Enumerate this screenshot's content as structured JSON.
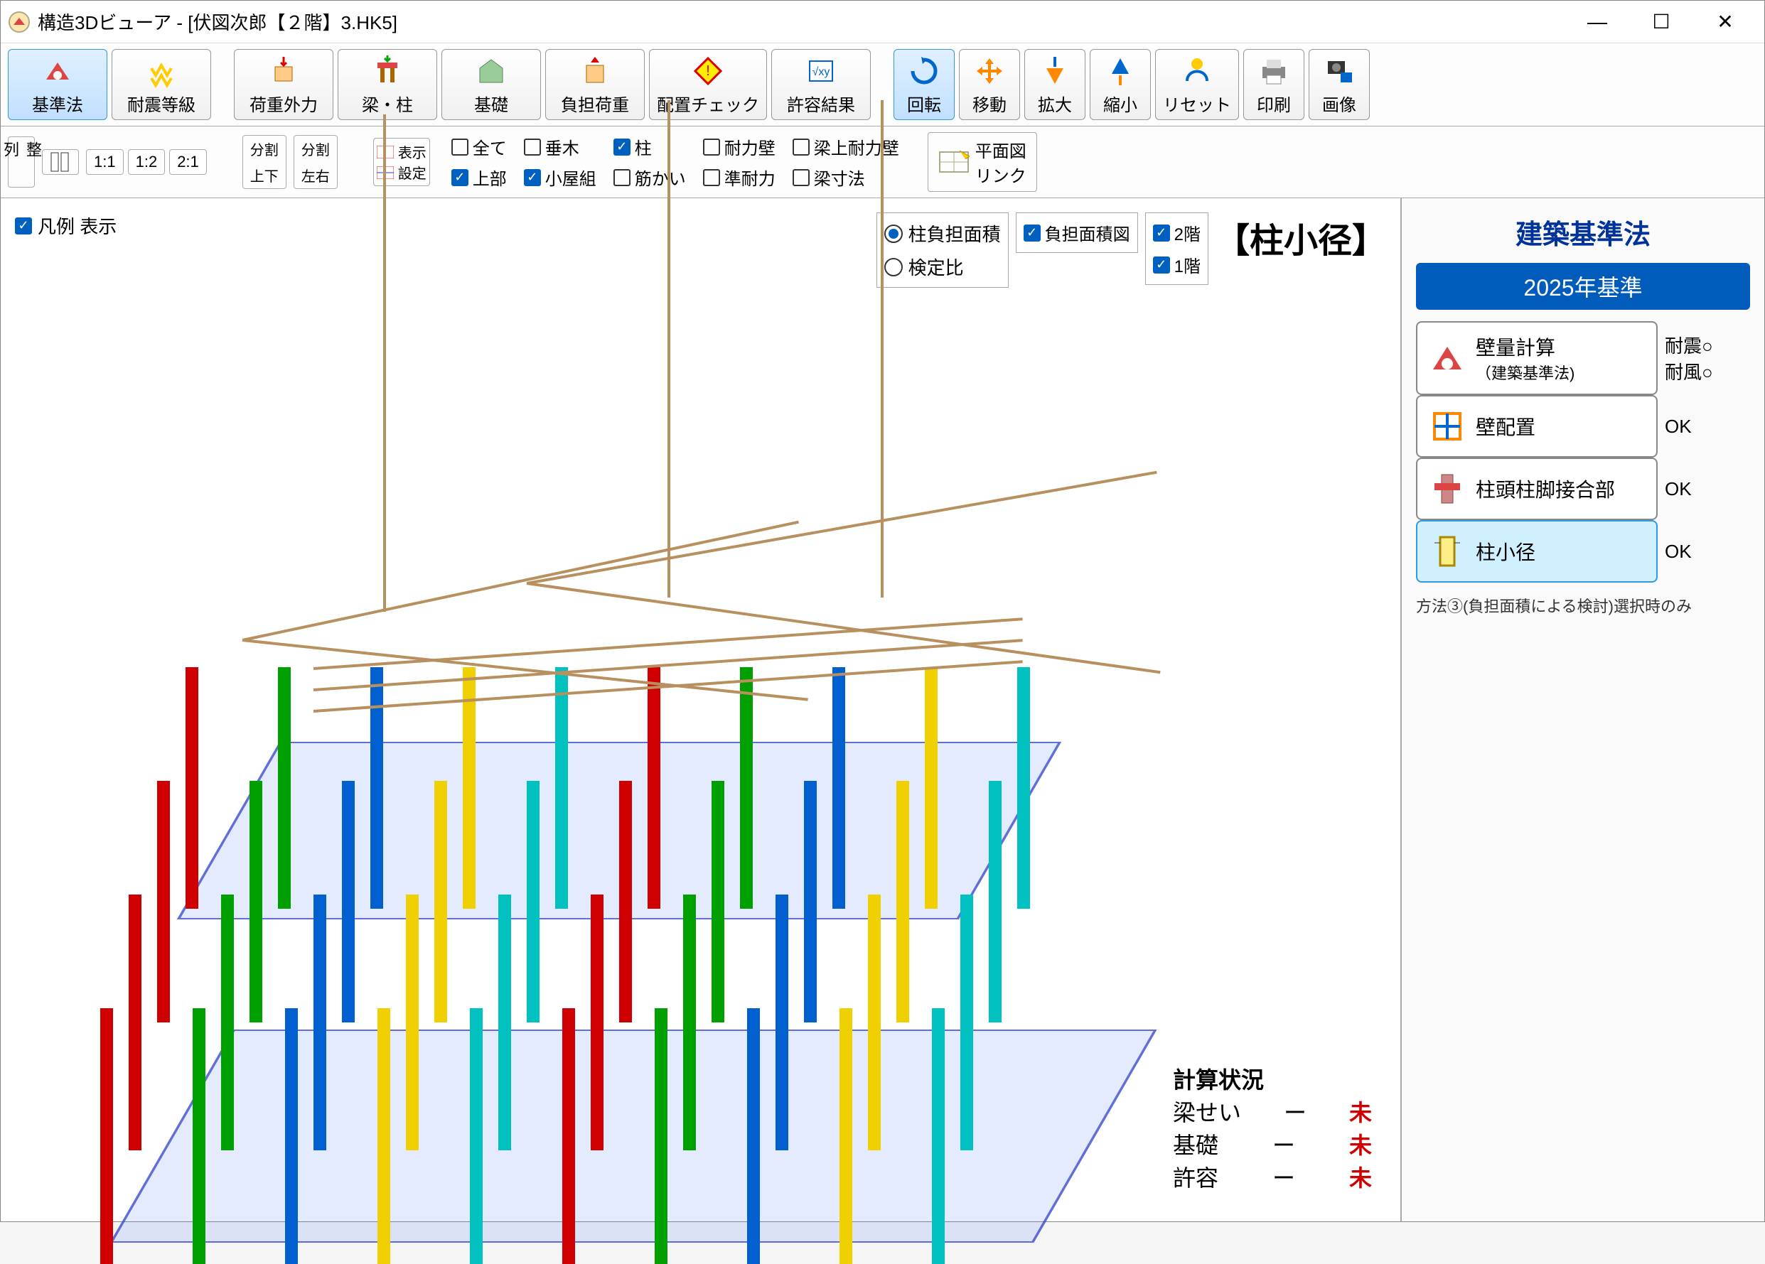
{
  "window": {
    "title": "構造3Dビューア - [伏図次郎【２階】3.HK5]"
  },
  "toolbar": [
    {
      "id": "kijun",
      "label": "基準法",
      "active": true
    },
    {
      "id": "taisin",
      "label": "耐震等級"
    },
    {
      "id": "kaju",
      "label": "荷重外力"
    },
    {
      "id": "hari",
      "label": "梁・柱"
    },
    {
      "id": "kiso",
      "label": "基礎"
    },
    {
      "id": "futan",
      "label": "負担荷重"
    },
    {
      "id": "haichi",
      "label": "配置チェック"
    },
    {
      "id": "kyoyo",
      "label": "許容結果"
    },
    {
      "id": "kaiten",
      "label": "回転",
      "active": true
    },
    {
      "id": "ido",
      "label": "移動"
    },
    {
      "id": "kakudai",
      "label": "拡大"
    },
    {
      "id": "shuku",
      "label": "縮小"
    },
    {
      "id": "reset",
      "label": "リセット"
    },
    {
      "id": "insatsu",
      "label": "印刷"
    },
    {
      "id": "gazou",
      "label": "画像"
    }
  ],
  "optrow": {
    "seiretsu": "整\n列",
    "ratios": [
      "1:1",
      "1:2",
      "2:1"
    ],
    "bunkatsu_joge": {
      "top": "分割",
      "bot": "上下"
    },
    "bunkatsu_sayu": {
      "top": "分割",
      "bot": "左右"
    },
    "hyouji": "表示",
    "settei": "設定",
    "checks": {
      "subete": {
        "label": "全て",
        "on": false
      },
      "taruki": {
        "label": "垂木",
        "on": false
      },
      "hashira": {
        "label": "柱",
        "on": true
      },
      "tairyoku": {
        "label": "耐力壁",
        "on": false
      },
      "hariue": {
        "label": "梁上耐力壁",
        "on": false
      },
      "joubu": {
        "label": "上部",
        "on": true
      },
      "koyagumi": {
        "label": "小屋組",
        "on": true
      },
      "sujikai": {
        "label": "筋かい",
        "on": false
      },
      "juntai": {
        "label": "準耐力",
        "on": false
      },
      "harisunpo": {
        "label": "梁寸法",
        "on": false
      }
    },
    "heimenzu": "平面図",
    "link": "リンク"
  },
  "legend": {
    "label": "凡例 表示",
    "on": true
  },
  "filter": {
    "radio": [
      {
        "label": "柱負担面積",
        "on": true
      },
      {
        "label": "検定比",
        "on": false
      }
    ],
    "futanzu": {
      "label": "負担面積図",
      "on": true
    },
    "floors": [
      {
        "label": "2階",
        "on": true
      },
      {
        "label": "1階",
        "on": true
      }
    ],
    "title": "【柱小径】"
  },
  "status": {
    "header": "計算状況",
    "rows": [
      {
        "name": "梁せい",
        "sep": "ー",
        "val": "未"
      },
      {
        "name": "基礎",
        "sep": "ー",
        "val": "未"
      },
      {
        "name": "許容",
        "sep": "ー",
        "val": "未"
      }
    ]
  },
  "sidebar": {
    "title": "建築基準法",
    "year": "2025年基準",
    "items": [
      {
        "id": "hekiryo",
        "label": "壁量計算",
        "sub": "（建築基準法)",
        "status": [
          "耐震○",
          "耐風○"
        ]
      },
      {
        "id": "kabe",
        "label": "壁配置",
        "status": [
          "OK"
        ]
      },
      {
        "id": "chutou",
        "label": "柱頭柱脚接合部",
        "status": [
          "OK"
        ]
      },
      {
        "id": "chushokei",
        "label": "柱小径",
        "status": [
          "OK"
        ],
        "active": true
      }
    ],
    "note": "方法③(負担面積による検討)選択時のみ"
  }
}
